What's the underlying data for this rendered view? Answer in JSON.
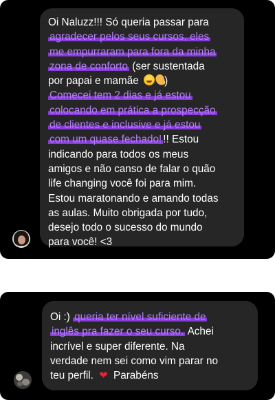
{
  "messages": [
    {
      "lines": [
        {
          "segments": [
            {
              "text": "Oi Naluzz!!! Só queria passar para",
              "highlight": false
            }
          ]
        },
        {
          "segments": [
            {
              "text": "agradecer pelos seus cursos, eles",
              "highlight": true
            }
          ]
        },
        {
          "segments": [
            {
              "text": "me empurraram para fora da minha",
              "highlight": true
            }
          ]
        },
        {
          "segments": [
            {
              "text": "zona de conforto",
              "highlight": true
            },
            {
              "text": " (ser sustentada",
              "highlight": false
            }
          ]
        },
        {
          "segments": [
            {
              "text": "por papai e mamãe ",
              "highlight": false
            }
          ],
          "emojis": [
            "laughing-face",
            "pinching-hand"
          ],
          "after": ")"
        },
        {
          "segments": [
            {
              "text": "Comecei tem 2 dias e já estou",
              "highlight": true
            }
          ]
        },
        {
          "segments": [
            {
              "text": "colocando em prática a prospecção",
              "highlight": true
            }
          ]
        },
        {
          "segments": [
            {
              "text": "de clientes e inclusive e já estou",
              "highlight": true
            }
          ]
        },
        {
          "segments": [
            {
              "text": "com um quase fechado!",
              "highlight": true
            },
            {
              "text": "!! Estou",
              "highlight": false
            }
          ]
        },
        {
          "segments": [
            {
              "text": "indicando para todos os meus",
              "highlight": false
            }
          ]
        },
        {
          "segments": [
            {
              "text": "amigos e não canso de falar o quão",
              "highlight": false
            }
          ]
        },
        {
          "segments": [
            {
              "text": "life changing você foi para mim.",
              "highlight": false
            }
          ]
        },
        {
          "segments": [
            {
              "text": "Estou maratonando e amando todas",
              "highlight": false
            }
          ]
        },
        {
          "segments": [
            {
              "text": "as aulas. Muito obrigada por tudo,",
              "highlight": false
            }
          ]
        },
        {
          "segments": [
            {
              "text": "desejo todo o sucesso do mundo",
              "highlight": false
            }
          ]
        },
        {
          "segments": [
            {
              "text": "para você! <3",
              "highlight": false
            }
          ]
        }
      ]
    },
    {
      "lines": [
        {
          "segments": [
            {
              "text": "Oi :) ",
              "highlight": false
            },
            {
              "text": "queria ter nível suficiente de",
              "highlight": true
            }
          ]
        },
        {
          "segments": [
            {
              "text": "inglês pra fazer o seu curso.",
              "highlight": true
            },
            {
              "text": " Achei",
              "highlight": false
            }
          ]
        },
        {
          "segments": [
            {
              "text": "incrível e super diferente. Na",
              "highlight": false
            }
          ]
        },
        {
          "segments": [
            {
              "text": "verdade nem sei como vim parar no",
              "highlight": false
            }
          ]
        },
        {
          "segments": [
            {
              "text": "teu perfil. ",
              "highlight": false
            }
          ],
          "emojis": [
            "red-heart"
          ],
          "after": " Parabéns"
        }
      ]
    }
  ],
  "colors": {
    "panel": "#000000",
    "bubble": "#262626",
    "text": "#ffffff",
    "highlight": "#8e3fe6"
  }
}
